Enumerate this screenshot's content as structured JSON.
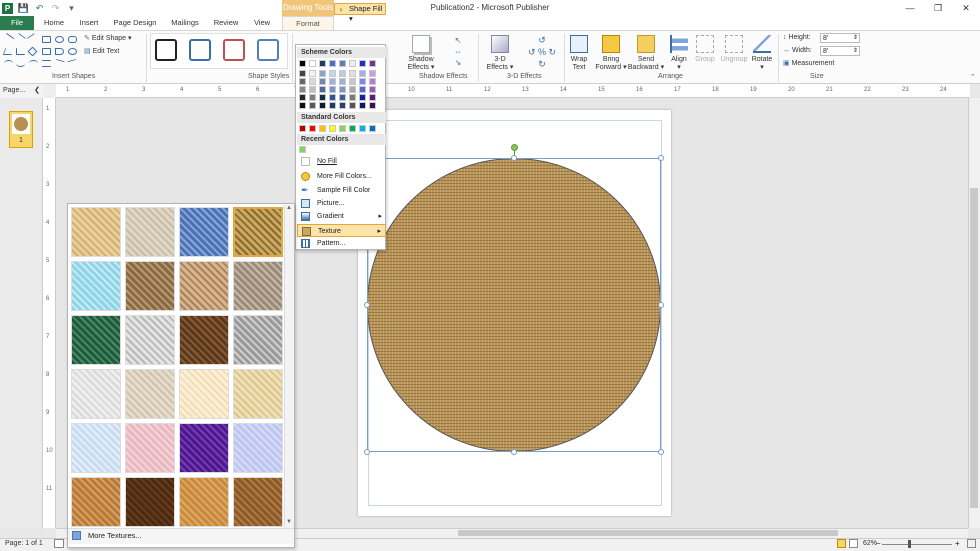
{
  "window": {
    "title": "Publication2 - Microsoft Publisher",
    "context_tab_group": "Drawing Tools",
    "controls": [
      "minimize-icon",
      "restore-icon",
      "close-icon"
    ]
  },
  "quick_access": [
    "publisher-icon",
    "save-icon",
    "undo-icon",
    "redo-icon",
    "customize-icon"
  ],
  "tabs": {
    "file": "File",
    "home": "Home",
    "insert": "Insert",
    "page_design": "Page Design",
    "mailings": "Mailings",
    "review": "Review",
    "view": "View",
    "format": "Format"
  },
  "ribbon": {
    "insert_shapes": {
      "label": "Insert Shapes",
      "edit_shape": "Edit Shape",
      "edit_text": "Edit Text"
    },
    "shape_styles": {
      "label": "Shape Styles",
      "shape_fill": "Shape Fill"
    },
    "shadow_effects": {
      "label": "Shadow Effects",
      "shadow_button": "Shadow\nEffects"
    },
    "three_d": {
      "label": "3-D Effects",
      "button": "3-D\nEffects"
    },
    "arrange": {
      "label": "Arrange",
      "wrap_text": "Wrap\nText",
      "bring_forward": "Bring\nForward",
      "send_backward": "Send\nBackward",
      "align": "Align",
      "group": "Group",
      "ungroup": "Ungroup",
      "rotate": "Rotate"
    },
    "size": {
      "label": "Size",
      "height_label": "Height:",
      "height_value": "8'",
      "width_label": "Width:",
      "width_value": "8'",
      "measurement": "Measurement"
    },
    "style_colors": [
      "#111111",
      "#3a6ea5",
      "#c0504d",
      "#4f81bd"
    ]
  },
  "page_nav": {
    "title": "Page...",
    "thumb_number": "1"
  },
  "rulers": {
    "horizontal": [
      "1",
      "2",
      "3",
      "4",
      "5",
      "6",
      "7",
      "8",
      "9",
      "10",
      "11",
      "12",
      "13",
      "14",
      "15",
      "16",
      "17",
      "18",
      "19",
      "20",
      "21",
      "22",
      "23",
      "24"
    ],
    "vertical": [
      "1",
      "2",
      "3",
      "4",
      "5",
      "6",
      "7",
      "8",
      "9",
      "10",
      "11"
    ]
  },
  "color_menu": {
    "scheme_header": "Scheme Colors",
    "scheme_top": [
      "#000000",
      "#ffffff",
      "#1f3864",
      "#4472c4",
      "#5a7fbf",
      "#eeeeee",
      "#1f2fcc",
      "#7b2d9b"
    ],
    "scheme_shades": [
      [
        "#444444",
        "#f2f2f2",
        "#8ea3c9",
        "#c7d4ee",
        "#bfcbe6",
        "#e0e0e0",
        "#a6acf0",
        "#caa0dc"
      ],
      [
        "#666666",
        "#d9d9d9",
        "#6e88b8",
        "#9ab3e0",
        "#9fb1d9",
        "#c8c8c8",
        "#7f88e8",
        "#b17ed0"
      ],
      [
        "#888888",
        "#bfbfbf",
        "#4d6aa3",
        "#7395d2",
        "#7f97cc",
        "#aaaaaa",
        "#5a64e0",
        "#9a5cc3"
      ],
      [
        "#262626",
        "#7f7f7f",
        "#162a4c",
        "#2f559a",
        "#3f5f9a",
        "#7a7a7a",
        "#141fa0",
        "#5a1f74"
      ],
      [
        "#0d0d0d",
        "#595959",
        "#0e1b33",
        "#1f3a6a",
        "#2a406a",
        "#555555",
        "#0d146c",
        "#3c154e"
      ]
    ],
    "standard_header": "Standard Colors",
    "standard": [
      "#c00000",
      "#ff0000",
      "#ffc000",
      "#ffff00",
      "#92d050",
      "#00b050",
      "#00b0f0",
      "#0070c0"
    ],
    "recent_header": "Recent Colors",
    "recent": [
      "#7fd85a"
    ],
    "items": {
      "no_fill": "No Fill",
      "more_colors": "More Fill Colors...",
      "sample": "Sample Fill Color",
      "picture": "Picture...",
      "gradient": "Gradient",
      "texture": "Texture",
      "pattern": "Pattern..."
    }
  },
  "texture_gallery": {
    "textures": [
      {
        "name": "papyrus",
        "c1": "#e8cf9b",
        "c2": "#d4b070"
      },
      {
        "name": "canvas",
        "c1": "#ded6c6",
        "c2": "#c9bca6"
      },
      {
        "name": "denim",
        "c1": "#4a72b5",
        "c2": "#8aa8d8"
      },
      {
        "name": "woven-mat",
        "c1": "#c9a860",
        "c2": "#8a6a30"
      },
      {
        "name": "water-droplets",
        "c1": "#8fd3e8",
        "c2": "#c4ecf4"
      },
      {
        "name": "paper-bag",
        "c1": "#8a6a45",
        "c2": "#b89a70"
      },
      {
        "name": "fish-fossil",
        "c1": "#d8b48a",
        "c2": "#a88060"
      },
      {
        "name": "sand",
        "c1": "#9a8a7a",
        "c2": "#c7b8a8"
      },
      {
        "name": "green-marble",
        "c1": "#1f5a3a",
        "c2": "#4a8a6a"
      },
      {
        "name": "white-marble",
        "c1": "#e4e4e4",
        "c2": "#b8b8b8"
      },
      {
        "name": "brown-marble",
        "c1": "#5a3a1f",
        "c2": "#8a5a30"
      },
      {
        "name": "granite",
        "c1": "#9a9a9a",
        "c2": "#d0d0d0"
      },
      {
        "name": "newsprint",
        "c1": "#eeeeee",
        "c2": "#d8d8d8"
      },
      {
        "name": "recycled-paper",
        "c1": "#e6dccc",
        "c2": "#cfc3ae"
      },
      {
        "name": "parchment",
        "c1": "#fcefd8",
        "c2": "#f2dcb4"
      },
      {
        "name": "stationery",
        "c1": "#f0e0b8",
        "c2": "#dcc48c"
      },
      {
        "name": "blue-tissue-paper",
        "c1": "#c8dcf4",
        "c2": "#e8f0fc"
      },
      {
        "name": "pink-tissue-paper",
        "c1": "#eab8c0",
        "c2": "#f4d4d8"
      },
      {
        "name": "purple-mesh",
        "c1": "#4a1a8a",
        "c2": "#7a3ab8"
      },
      {
        "name": "bouquet",
        "c1": "#b8c8f0",
        "c2": "#e0d8f8"
      },
      {
        "name": "cork",
        "c1": "#b87a3a",
        "c2": "#d8a060"
      },
      {
        "name": "walnut",
        "c1": "#4a2a12",
        "c2": "#6a3c1c"
      },
      {
        "name": "oak",
        "c1": "#c88a40",
        "c2": "#e0a860"
      },
      {
        "name": "medium-wood",
        "c1": "#8a5a2a",
        "c2": "#b07a40"
      }
    ],
    "selected_index": 3,
    "more_textures": "More Textures..."
  },
  "canvas": {
    "shape": "circle",
    "fill": "texture woven-mat"
  },
  "status": {
    "page": "Page: 1 of 1",
    "zoom": "62%"
  }
}
